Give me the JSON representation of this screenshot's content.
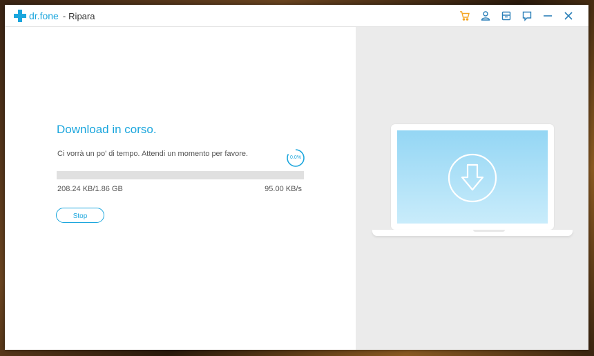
{
  "app": {
    "brand": "dr.fone",
    "separator": "-",
    "module": "Ripara"
  },
  "toolbar_icons": [
    "cart-icon",
    "user-icon",
    "feedback-icon",
    "chat-icon",
    "minimize-icon",
    "close-icon"
  ],
  "colors": {
    "accent": "#1ba6dd",
    "cart": "#f5a623",
    "panel": "#ebebeb"
  },
  "download": {
    "title": "Download in corso.",
    "message": "Ci vorrà un po' di tempo. Attendi un momento per favore.",
    "percent_label": "0.0%",
    "progress_fraction": 0.0,
    "size": "208.24 KB/1.86 GB",
    "speed": "95.00 KB/s",
    "stop_label": "Stop"
  }
}
